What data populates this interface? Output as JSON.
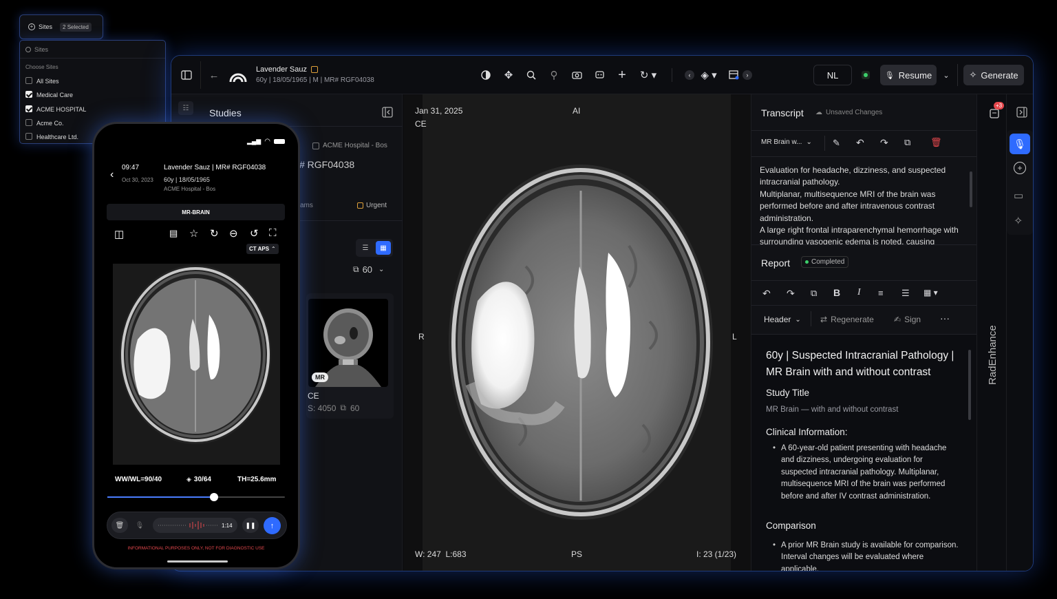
{
  "sites_chip": {
    "label": "Sites",
    "selected": "2 Selected"
  },
  "sites_dropdown": {
    "search_placeholder": "Sites",
    "section_label": "Choose Sites",
    "options": [
      {
        "label": "All Sites",
        "checked": false
      },
      {
        "label": "Medical Care",
        "checked": true
      },
      {
        "label": "ACME HOSPITAL",
        "checked": true
      },
      {
        "label": "Acme Co.",
        "checked": false
      },
      {
        "label": "Healthcare Ltd.",
        "checked": false
      }
    ]
  },
  "header": {
    "patient_name": "Lavender Sauz",
    "patient_meta": "60y | 18/05/1965 | M | MR# RGF04038",
    "language": "NL",
    "resume_label": "Resume",
    "generate_label": "Generate"
  },
  "studies": {
    "title": "Studies",
    "site": "ACME Hospital - Bos",
    "mr_number": "# RGF04038",
    "exams_fragment": "ams",
    "urgent_label": "Urgent",
    "count": "60",
    "card": {
      "badge": "MR",
      "series": "CE",
      "s_label": "S: 4050",
      "images": "60"
    }
  },
  "viewer": {
    "date": "Jan 31, 2025",
    "sequence": "CE",
    "ai_label": "AI",
    "left_marker": "R",
    "right_marker": "L",
    "window_level": "W: 247  L:683",
    "bottom_marker": "PS",
    "image_index": "I: 23 (1/23)"
  },
  "transcript": {
    "title": "Transcript",
    "status": "Unsaved Changes",
    "template": "MR Brain w...",
    "text": "Evaluation for headache, dizziness, and suspected intracranial pathology.\nMultiplanar, multisequence MRI of the brain was performed before and after intravenous contrast administration.\nA large right frontal intraparenchymal hemorrhage with surrounding vasogenic edema is noted, causing"
  },
  "report": {
    "title": "Report",
    "status": "Completed",
    "section_dropdown": "Header",
    "regenerate_label": "Regenerate",
    "sign_label": "Sign",
    "heading": "60y | Suspected Intracranial Pathology | MR Brain with and without contrast",
    "study_title_label": "Study Title",
    "study_title_value": "MR Brain — with and without contrast",
    "clinical_label": "Clinical Information:",
    "clinical_text": "A 60-year-old patient presenting with headache and dizziness, undergoing evaluation for suspected intracranial pathology. Multiplanar, multisequence MRI of the brain was performed before and after IV contrast administration.",
    "comparison_label": "Comparison",
    "comparison_text": "A prior MR Brain study is available for comparison. Interval changes will be evaluated where applicable."
  },
  "rail": {
    "notification_count": "+3",
    "brand": "RadEnhance"
  },
  "phone": {
    "time": "09:47",
    "date": "Oct 30, 2023",
    "patient": "Lavender Sauz | MR# RGF04038",
    "patient_meta": "60y | 18/05/1965",
    "site": "ACME Hospital - Bos",
    "study_label": "MR-BRAIN",
    "series_toggle": "CT APS",
    "window_level": "WW/WL=90/40",
    "slice": "30/64",
    "thickness": "TH=25.6mm",
    "slider_value": 0.6,
    "recording_time": "1:14",
    "disclaimer": "INFORMATIONAL PURPOSES ONLY, NOT FOR DIAGNOSTIC USE"
  },
  "colors": {
    "accent_blue": "#2f6bff",
    "completed_green": "#3ccf6a",
    "urgent_orange": "#e0a13a",
    "danger_red": "#e5484d"
  }
}
